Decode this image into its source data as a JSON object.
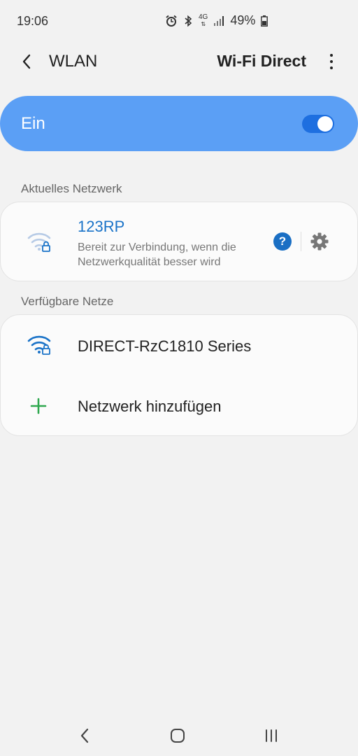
{
  "status_bar": {
    "time": "19:06",
    "battery_percent": "49%",
    "network_type": "4G",
    "icons": [
      "alarm-icon",
      "bluetooth-icon",
      "4g-data-icon",
      "signal-icon",
      "battery-icon"
    ]
  },
  "app_bar": {
    "title": "WLAN",
    "wifi_direct_label": "Wi-Fi Direct"
  },
  "master_toggle": {
    "label": "Ein",
    "state": true
  },
  "current_network": {
    "section_label": "Aktuelles Netzwerk",
    "name": "123RP",
    "status": "Bereit zur Verbindung, wenn die Netzwerkqualität besser wird",
    "help_label": "?"
  },
  "available_networks": {
    "section_label": "Verfügbare Netze",
    "items": [
      {
        "name": "DIRECT-RzC1810 Series"
      }
    ],
    "add_network_label": "Netzwerk hinzufügen"
  },
  "colors": {
    "accent": "#1a73c8",
    "toggle_card": "#5b9ff5",
    "add_icon": "#2fa84f"
  }
}
